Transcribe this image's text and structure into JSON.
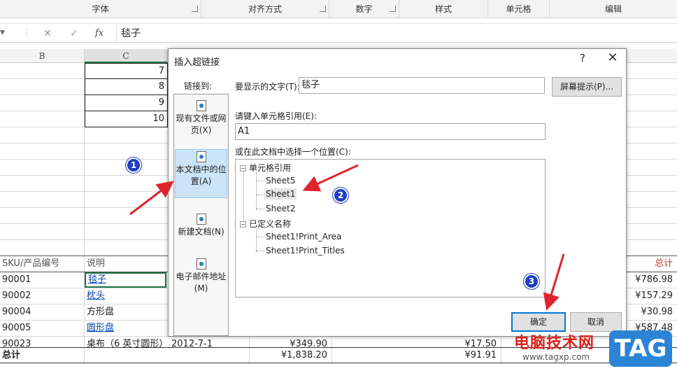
{
  "ribbon": {
    "groups": [
      "字体",
      "对齐方式",
      "数字",
      "样式",
      "单元格",
      "编辑"
    ]
  },
  "formula_bar": {
    "cancel": "✕",
    "enter": "✓",
    "fx": "fx",
    "value": "毯子"
  },
  "columns": [
    "B",
    "C"
  ],
  "numbers": [
    "7",
    "8",
    "9",
    "10"
  ],
  "table": {
    "headers": {
      "sku": "SKU/产品编号",
      "desc": "说明",
      "total": "总计"
    },
    "rows": [
      {
        "sku": "90001",
        "desc": "毯子",
        "total": "¥786.98"
      },
      {
        "sku": "90002",
        "desc": "枕头",
        "total": "¥157.29"
      },
      {
        "sku": "90004",
        "desc": "方形盘",
        "total": "¥30.98"
      },
      {
        "sku": "90005",
        "desc": "圆形盘",
        "total": "¥587.48"
      },
      {
        "sku": "90023",
        "desc": "桌布（6 英寸圆形）",
        "date": "2012-7-1",
        "amount": "¥349.90",
        "unit": "¥17.50"
      }
    ],
    "summary": {
      "label": "总计",
      "amount": "¥1,838.20",
      "unit": "¥91.91"
    }
  },
  "dialog": {
    "title": "插入超链接",
    "help": "?",
    "close": "✕",
    "link_to_label": "链接到:",
    "link_types": [
      {
        "label": "现有文件或网页(X)",
        "icon": "file-web-icon"
      },
      {
        "label": "本文档中的位置(A)",
        "icon": "document-place-icon"
      },
      {
        "label": "新建文档(N)",
        "icon": "new-document-icon"
      },
      {
        "label": "电子邮件地址(M)",
        "icon": "email-icon"
      }
    ],
    "display_text_label": "要显示的文字(T):",
    "display_text_value": "毯子",
    "screentip_button": "屏幕提示(P)...",
    "cell_ref_label": "请键入单元格引用(E):",
    "cell_ref_value": "A1",
    "place_label": "或在此文档中选择一个位置(C):",
    "tree": {
      "cell_refs": "单元格引用",
      "sheets": [
        "Sheet5",
        "Sheet1",
        "Sheet2"
      ],
      "defined_names": "已定义名称",
      "names": [
        "Sheet1!Print_Area",
        "Sheet1!Print_Titles"
      ]
    },
    "ok_button": "确定",
    "cancel_button": "取消"
  },
  "annotations": [
    "1",
    "2",
    "3"
  ],
  "colors": {
    "accent": "#0078d7",
    "arrow": "#e0242c",
    "badge": "#1f3fbf",
    "total_header": "#c0392b"
  },
  "watermark": {
    "text": "电脑技术网",
    "url": "www.tagxp.com",
    "tag": "TAG"
  }
}
